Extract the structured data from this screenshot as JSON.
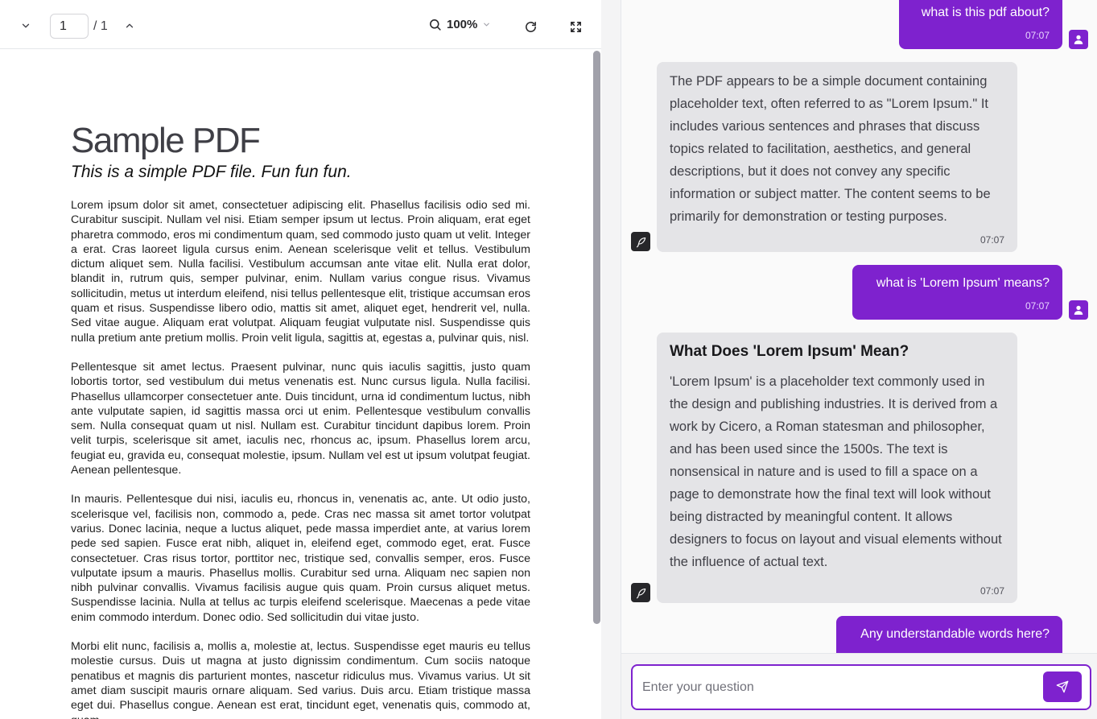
{
  "toolbar": {
    "page_current": "1",
    "page_total": "/ 1",
    "zoom_level": "100%"
  },
  "pdf": {
    "title": "Sample PDF",
    "subtitle": "This is a simple PDF file. Fun fun fun.",
    "paragraphs": [
      "Lorem ipsum dolor sit amet, consectetuer adipiscing elit. Phasellus facilisis odio sed mi. Curabitur suscipit. Nullam vel nisi. Etiam semper ipsum ut lectus. Proin aliquam, erat eget pharetra commodo, eros mi condimentum quam, sed commodo justo quam ut velit. Integer a erat. Cras laoreet ligula cursus enim. Aenean scelerisque velit et tellus. Vestibulum dictum aliquet sem. Nulla facilisi. Vestibulum accumsan ante vitae elit. Nulla erat dolor, blandit in, rutrum quis, semper pulvinar, enim. Nullam varius congue risus. Vivamus sollicitudin, metus ut interdum eleifend, nisi tellus pellentesque elit, tristique accumsan eros quam et risus. Suspendisse libero odio, mattis sit amet, aliquet eget, hendrerit vel, nulla. Sed vitae augue. Aliquam erat volutpat. Aliquam feugiat vulputate nisl. Suspendisse quis nulla pretium ante pretium mollis. Proin velit ligula, sagittis at, egestas a, pulvinar quis, nisl.",
      "Pellentesque sit amet lectus. Praesent pulvinar, nunc quis iaculis sagittis, justo quam lobortis tortor, sed vestibulum dui metus venenatis est. Nunc cursus ligula. Nulla facilisi. Phasellus ullamcorper consectetuer ante. Duis tincidunt, urna id condimentum luctus, nibh ante vulputate sapien, id sagittis massa orci ut enim. Pellentesque vestibulum convallis sem. Nulla consequat quam ut nisl. Nullam est. Curabitur tincidunt dapibus lorem. Proin velit turpis, scelerisque sit amet, iaculis nec, rhoncus ac, ipsum. Phasellus lorem arcu, feugiat eu, gravida eu, consequat molestie, ipsum. Nullam vel est ut ipsum volutpat feugiat. Aenean pellentesque.",
      "In mauris. Pellentesque dui nisi, iaculis eu, rhoncus in, venenatis ac, ante. Ut odio justo, scelerisque vel, facilisis non, commodo a, pede. Cras nec massa sit amet tortor volutpat varius. Donec lacinia, neque a luctus aliquet, pede massa imperdiet ante, at varius lorem pede sed sapien. Fusce erat nibh, aliquet in, eleifend eget, commodo eget, erat. Fusce consectetuer. Cras risus tortor, porttitor nec, tristique sed, convallis semper, eros. Fusce vulputate ipsum a mauris. Phasellus mollis. Curabitur sed urna. Aliquam nec sapien non nibh pulvinar convallis. Vivamus facilisis augue quis quam. Proin cursus aliquet metus. Suspendisse lacinia. Nulla at tellus ac turpis eleifend scelerisque. Maecenas a pede vitae enim commodo interdum. Donec odio. Sed sollicitudin dui vitae justo.",
      "Morbi elit nunc, facilisis a, mollis a, molestie at, lectus. Suspendisse eget mauris eu tellus molestie cursus. Duis ut magna at justo dignissim condimentum. Cum sociis natoque penatibus et magnis dis parturient montes, nascetur ridiculus mus. Vivamus varius. Ut sit amet diam suscipit mauris ornare aliquam. Sed varius. Duis arcu. Etiam tristique massa eget dui. Phasellus congue. Aenean est erat, tincidunt eget, venenatis quis, commodo at, quam."
    ]
  },
  "chat": {
    "messages": [
      {
        "role": "user",
        "text": "what is this pdf about?",
        "time": "07:07"
      },
      {
        "role": "bot",
        "text": "The PDF appears to be a simple document containing placeholder text, often referred to as \"Lorem Ipsum.\" It includes various sentences and phrases that discuss topics related to facilitation, aesthetics, and general descriptions, but it does not convey any specific information or subject matter. The content seems to be primarily for demonstration or testing purposes.",
        "time": "07:07"
      },
      {
        "role": "user",
        "text": "what is 'Lorem Ipsum' means?",
        "time": "07:07"
      },
      {
        "role": "bot",
        "heading": "What Does 'Lorem Ipsum' Mean?",
        "text": "'Lorem Ipsum' is a placeholder text commonly used in the design and publishing industries. It is derived from a work by Cicero, a Roman statesman and philosopher, and has been used since the 1500s. The text is nonsensical in nature and is used to fill a space on a page to demonstrate how the final text will look without being distracted by meaningful content. It allows designers to focus on layout and visual elements without the influence of actual text.",
        "time": "07:07"
      },
      {
        "role": "user",
        "text": "Any understandable words here?"
      }
    ]
  },
  "input": {
    "placeholder": "Enter your question"
  },
  "icons": {
    "prev_page": "chevron-down-icon",
    "next_page": "chevron-up-icon",
    "zoom": "search-icon",
    "zoom_dropdown": "chevron-down-icon",
    "rotate": "refresh-icon",
    "fullscreen": "expand-icon",
    "user_avatar": "user-icon",
    "bot_avatar": "feather-icon",
    "send": "send-icon"
  },
  "colors": {
    "accent": "#7e22ce",
    "bot_bubble": "#e4e4e7",
    "bot_avatar": "#27272a"
  }
}
